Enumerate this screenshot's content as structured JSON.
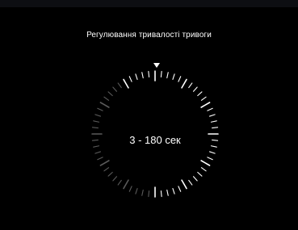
{
  "screen": {
    "title": "Регулювання тривалості тривоги",
    "dial_value": "3 - 180 сек"
  },
  "icons": {
    "pointer": "triangle-down-icon"
  },
  "colors": {
    "background": "#000000",
    "ticks_active": "#ffffff",
    "ticks_dim": "#5a5a5a"
  }
}
